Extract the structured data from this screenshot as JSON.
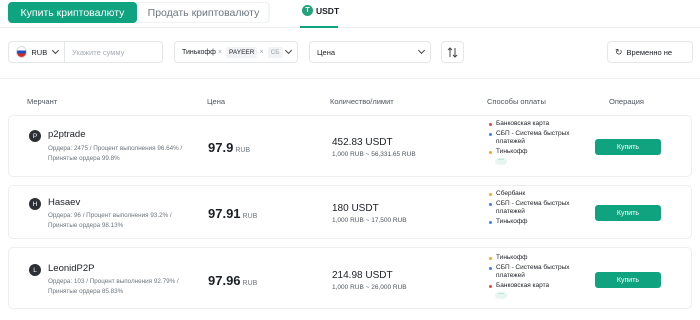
{
  "tabs": {
    "buy": "Купить криптовалюту",
    "sell": "Продать криптовалюту",
    "asset": "USDT",
    "asset_logo": "T"
  },
  "filters": {
    "currency": "RUB",
    "amount_placeholder": "Укажите сумму",
    "payment_chips": [
      "Тинькофф",
      "PAYEER",
      "СБ"
    ],
    "price_label": "Цена",
    "time_label": "Временно не"
  },
  "table": {
    "headers": {
      "merchant": "Мерчант",
      "price": "Цена",
      "quantity": "Количество/лимит",
      "methods": "Способы оплаты",
      "operation": "Операция"
    }
  },
  "rows": [
    {
      "initial": "P",
      "name": "p2ptrade",
      "stats_line1": "Ордера: 2475 / Процент выполнения 96.64% /",
      "stats_line2": "Принятые ордера 99.8%",
      "price": "97.9",
      "price_currency": "RUB",
      "quantity": "452.83 USDT",
      "limit": "1,000 RUB ~ 56,331.65 RUB",
      "methods": [
        {
          "name": "Банковская карта",
          "color": "#e5484d"
        },
        {
          "name": "СБП - Система быстрых платежей",
          "color": "#3b82f6"
        },
        {
          "name": "Тинькофф",
          "color": "#f5a623"
        }
      ],
      "more": "···",
      "action": "Купить"
    },
    {
      "initial": "H",
      "name": "Hasaev",
      "stats_line1": "Ордера: 96 / Процент выполнения 93.2% /",
      "stats_line2": "Принятые ордера 98.13%",
      "price": "97.91",
      "price_currency": "RUB",
      "quantity": "180 USDT",
      "limit": "1,000 RUB ~ 17,500 RUB",
      "methods": [
        {
          "name": "Сбербанк",
          "color": "#f5a623"
        },
        {
          "name": "СБП - Система быстрых платежей",
          "color": "#3b82f6"
        },
        {
          "name": "Тинькофф",
          "color": "#3b82f6"
        }
      ],
      "more": "",
      "action": "Купить"
    },
    {
      "initial": "L",
      "name": "LeonidP2P",
      "stats_line1": "Ордера: 103 / Процент выполнения 92.79% /",
      "stats_line2": "Принятые ордера 85.83%",
      "price": "97.96",
      "price_currency": "RUB",
      "quantity": "214.98 USDT",
      "limit": "1,000 RUB ~ 26,000 RUB",
      "methods": [
        {
          "name": "Тинькофф",
          "color": "#f5a623"
        },
        {
          "name": "СБП - Система быстрых платежей",
          "color": "#3b82f6"
        },
        {
          "name": "Банковская карта",
          "color": "#e5484d"
        }
      ],
      "more": "···",
      "action": "Купить"
    }
  ]
}
